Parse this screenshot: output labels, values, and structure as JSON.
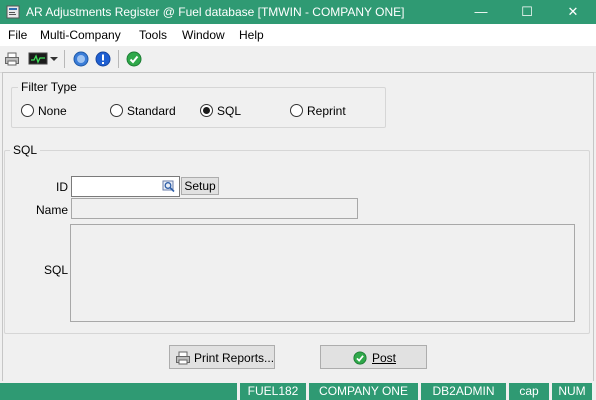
{
  "window": {
    "title": "AR Adjustments Register @ Fuel database [TMWIN - COMPANY ONE]",
    "controls": {
      "minimize": "—",
      "maximize": "☐",
      "close": "✕"
    }
  },
  "menu": [
    "File",
    "Multi-Company",
    "Tools",
    "Window",
    "Help"
  ],
  "toolbar": {
    "icons": [
      "printer-icon",
      "monitor-icon",
      "dropdown-arrow-icon",
      "help-icon",
      "info-icon",
      "check-icon"
    ]
  },
  "filter_type": {
    "legend": "Filter Type",
    "options": [
      {
        "label": "None",
        "checked": false
      },
      {
        "label": "Standard",
        "checked": false
      },
      {
        "label": "SQL",
        "checked": true
      },
      {
        "label": "Reprint",
        "checked": false
      }
    ]
  },
  "sql_group": {
    "legend": "SQL",
    "id_label": "ID",
    "id_value": "",
    "setup_label": "Setup",
    "name_label": "Name",
    "name_value": "",
    "sql_label": "SQL",
    "sql_value": ""
  },
  "actions": {
    "print_reports_label": "Print Reports...",
    "post_label": "Post"
  },
  "status": [
    "FUEL182",
    "COMPANY ONE",
    "DB2ADMIN",
    "cap",
    "NUM"
  ],
  "colors": {
    "accent": "#2f9a73",
    "background": "#f0f0f0"
  }
}
